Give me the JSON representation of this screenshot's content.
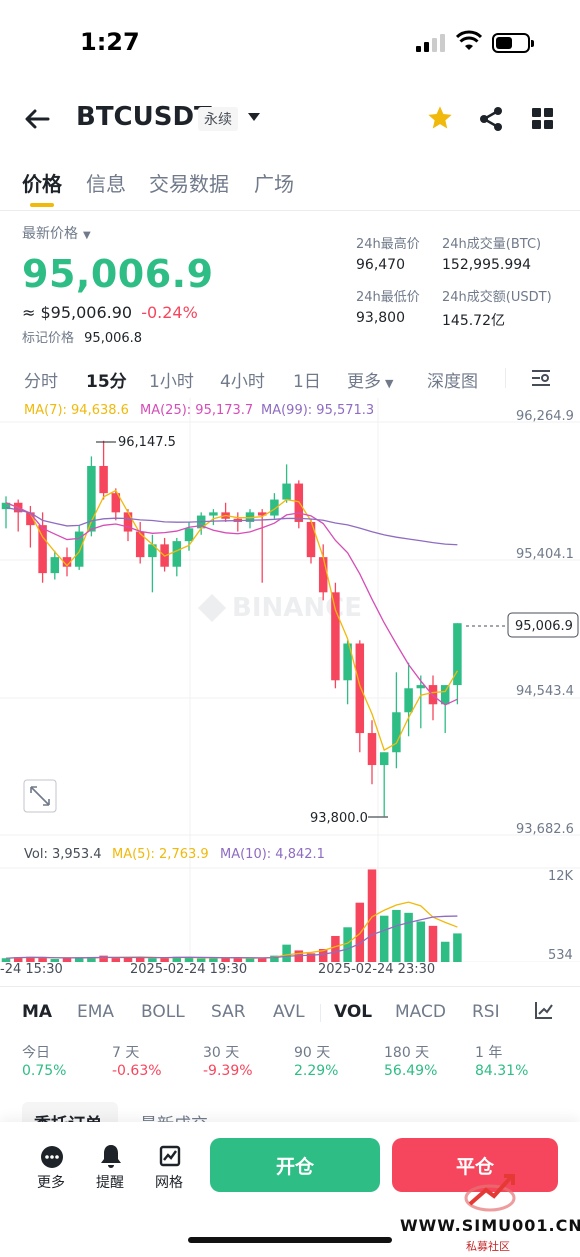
{
  "status_bar": {
    "time": "1:27"
  },
  "header": {
    "pair": "BTCUSDT",
    "contract_type": "永续"
  },
  "tabs": [
    {
      "label": "价格",
      "active": true
    },
    {
      "label": "信息",
      "active": false
    },
    {
      "label": "交易数据",
      "active": false
    },
    {
      "label": "广场",
      "active": false
    }
  ],
  "price": {
    "label": "最新价格",
    "last": "95,006.9",
    "fiat": "≈ $95,006.90",
    "change": "-0.24%",
    "mark_label": "标记价格",
    "mark_value": "95,006.8"
  },
  "stats": {
    "high_label": "24h最高价",
    "high_value": "96,470",
    "vol_btc_label": "24h成交量(BTC)",
    "vol_btc_value": "152,995.994",
    "low_label": "24h最低价",
    "low_value": "93,800",
    "vol_usdt_label": "24h成交额(USDT)",
    "vol_usdt_value": "145.72亿"
  },
  "intervals": [
    {
      "label": "分时",
      "active": false
    },
    {
      "label": "15分",
      "active": true
    },
    {
      "label": "1小时",
      "active": false
    },
    {
      "label": "4小时",
      "active": false
    },
    {
      "label": "1日",
      "active": false
    },
    {
      "label": "更多",
      "active": false
    },
    {
      "label": "深度图",
      "active": false
    }
  ],
  "ma_legend": {
    "ma7": "MA(7): 94,638.6",
    "ma25": "MA(25): 95,173.7",
    "ma99": "MA(99): 95,571.3"
  },
  "vol_legend": {
    "vol": "Vol: 3,953.4",
    "ma5": "MA(5): 2,763.9",
    "ma10": "MA(10): 4,842.1"
  },
  "chart_data": {
    "type": "candlestick",
    "y_ticks": [
      "96,264.9",
      "95,404.1",
      "94,543.4",
      "93,682.6"
    ],
    "current_price_tag": "95,006.9",
    "high_annotation": "96,147.5",
    "low_annotation": "93,800.0",
    "vol_ticks": [
      "12K",
      "534"
    ],
    "x_ticks": [
      "-24 15:30",
      "2025-02-24 19:30",
      "2025-02-24 23:30"
    ],
    "watermark": "BINANCE",
    "ylim": [
      93682.6,
      96264.9
    ],
    "candles": [
      [
        95720,
        95800,
        95600,
        95760
      ],
      [
        95760,
        95780,
        95580,
        95700
      ],
      [
        95700,
        95740,
        95480,
        95620
      ],
      [
        95620,
        95700,
        95260,
        95320
      ],
      [
        95320,
        95460,
        95280,
        95420
      ],
      [
        95420,
        95480,
        95300,
        95360
      ],
      [
        95360,
        95620,
        95340,
        95580
      ],
      [
        95580,
        96050,
        95550,
        95990
      ],
      [
        95990,
        96147.5,
        95780,
        95820
      ],
      [
        95820,
        95850,
        95650,
        95700
      ],
      [
        95700,
        95720,
        95520,
        95580
      ],
      [
        95580,
        95640,
        95380,
        95420
      ],
      [
        95420,
        95560,
        95200,
        95500
      ],
      [
        95500,
        95540,
        95330,
        95360
      ],
      [
        95360,
        95540,
        95300,
        95520
      ],
      [
        95520,
        95640,
        95460,
        95600
      ],
      [
        95600,
        95700,
        95560,
        95680
      ],
      [
        95680,
        95720,
        95620,
        95700
      ],
      [
        95700,
        95760,
        95640,
        95660
      ],
      [
        95660,
        95700,
        95580,
        95640
      ],
      [
        95640,
        95720,
        95600,
        95700
      ],
      [
        95700,
        95720,
        95260,
        95680
      ],
      [
        95680,
        95820,
        95660,
        95780
      ],
      [
        95780,
        96000,
        95760,
        95880
      ],
      [
        95880,
        95900,
        95600,
        95640
      ],
      [
        95640,
        95660,
        95380,
        95420
      ],
      [
        95420,
        95500,
        95150,
        95200
      ],
      [
        95200,
        95260,
        94600,
        94650
      ],
      [
        94650,
        94900,
        94500,
        94880
      ],
      [
        94880,
        94900,
        94200,
        94320
      ],
      [
        94320,
        94400,
        94000,
        94120
      ],
      [
        94120,
        94200,
        93800,
        94200
      ],
      [
        94200,
        94700,
        94100,
        94450
      ],
      [
        94450,
        94760,
        94300,
        94600
      ],
      [
        94600,
        94680,
        94350,
        94620
      ],
      [
        94620,
        94680,
        94400,
        94500
      ],
      [
        94500,
        94560,
        94320,
        94620
      ],
      [
        94620,
        95006.9,
        94500,
        95006.9
      ]
    ],
    "volume": [
      520,
      680,
      720,
      600,
      410,
      520,
      620,
      700,
      880,
      540,
      600,
      700,
      520,
      560,
      720,
      640,
      500,
      480,
      660,
      580,
      500,
      540,
      880,
      2400,
      1600,
      1200,
      1800,
      3600,
      4800,
      8200,
      12800,
      6400,
      7200,
      6800,
      5600,
      5000,
      2800,
      3953.4
    ]
  },
  "indicators": [
    {
      "label": "MA",
      "active": true
    },
    {
      "label": "EMA",
      "active": false
    },
    {
      "label": "BOLL",
      "active": false
    },
    {
      "label": "SAR",
      "active": false
    },
    {
      "label": "AVL",
      "active": false
    },
    {
      "label": "VOL",
      "active": true
    },
    {
      "label": "MACD",
      "active": false
    },
    {
      "label": "RSI",
      "active": false
    }
  ],
  "performance": [
    {
      "label": "今日",
      "value": "0.75%",
      "dir": "up"
    },
    {
      "label": "7 天",
      "value": "-0.63%",
      "dir": "down"
    },
    {
      "label": "30 天",
      "value": "-9.39%",
      "dir": "down"
    },
    {
      "label": "90 天",
      "value": "2.29%",
      "dir": "up"
    },
    {
      "label": "180 天",
      "value": "56.49%",
      "dir": "up"
    },
    {
      "label": "1 年",
      "value": "84.31%",
      "dir": "up"
    }
  ],
  "sub_tabs": [
    "委托订单",
    "最新成交"
  ],
  "bottom": {
    "more_label": "更多",
    "alert_label": "提醒",
    "grid_label": "网格",
    "open_label": "开仓",
    "close_label": "平仓"
  },
  "watermark_site": "WWW.SIMU001.CN",
  "watermark_site_sub": "私募社区",
  "colors": {
    "up": "#2ebd85",
    "down": "#f6465d",
    "brand": "#f0b90b",
    "ma7": "#f0b90b",
    "ma25": "#d64db8",
    "ma99": "#8e6cc2"
  }
}
